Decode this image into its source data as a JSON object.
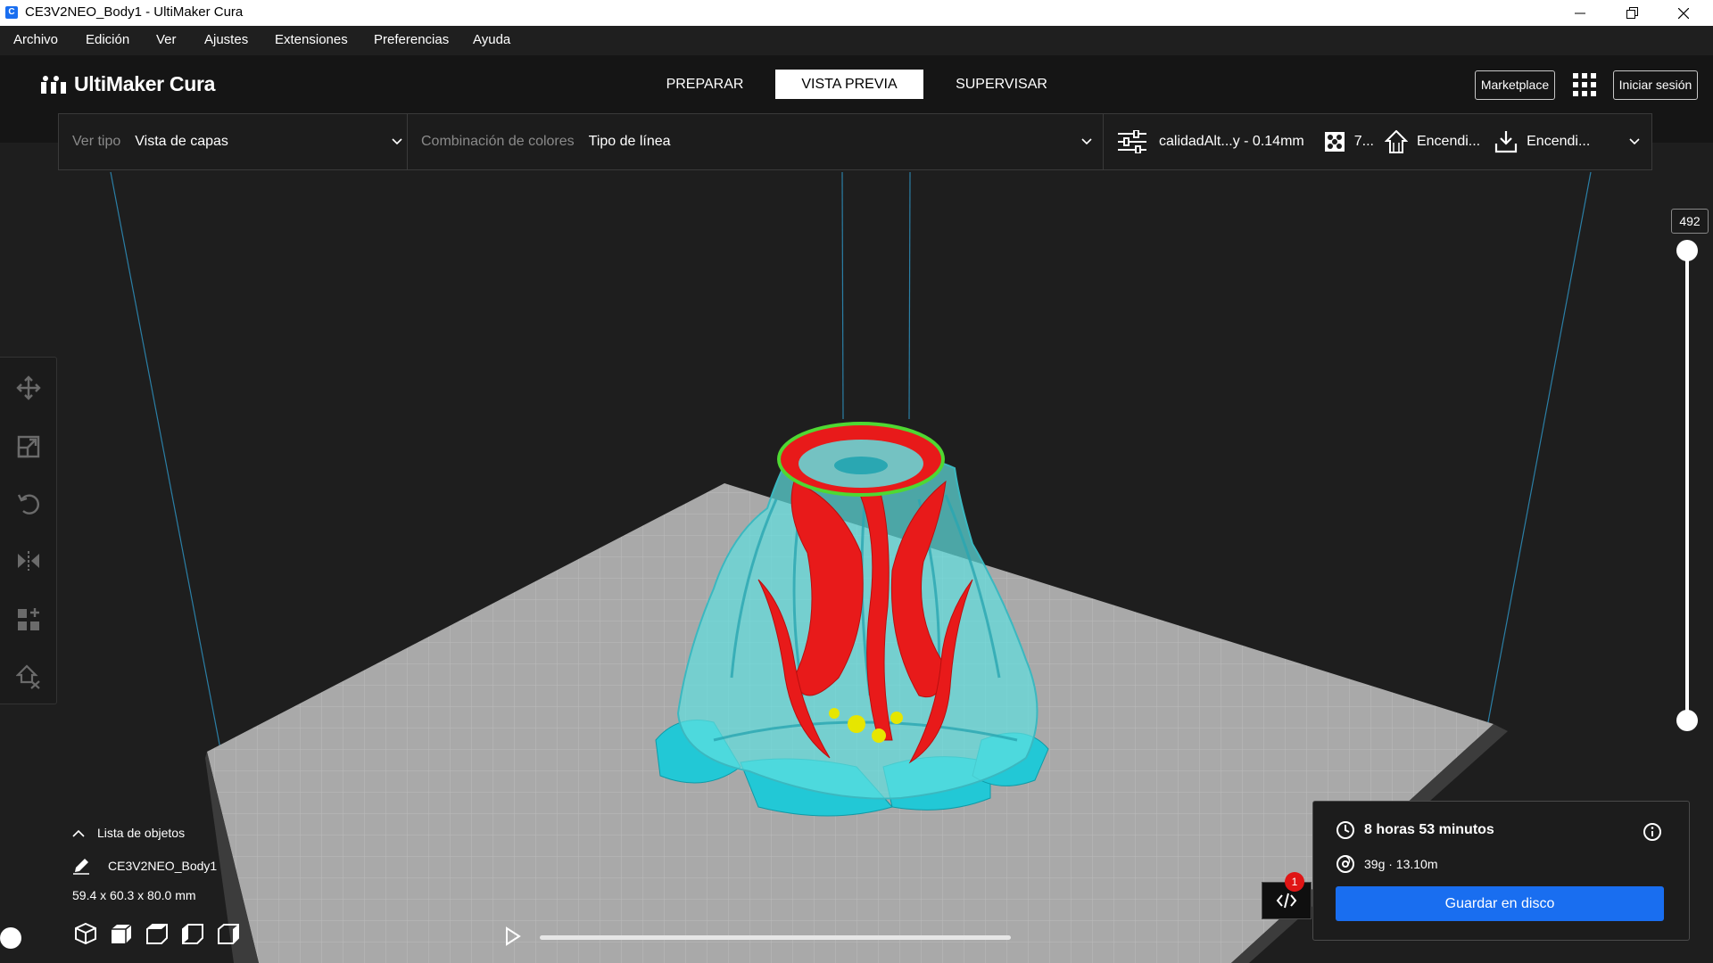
{
  "window": {
    "title": "CE3V2NEO_Body1 - UltiMaker Cura",
    "app_icon": "C",
    "controls": [
      "minimize-icon",
      "restore-icon",
      "close-icon"
    ]
  },
  "menu": [
    "Archivo",
    "Edición",
    "Ver",
    "Ajustes",
    "Extensiones",
    "Preferencias",
    "Ayuda"
  ],
  "header": {
    "logo": "UltiMaker Cura",
    "tabs": [
      {
        "label": "PREPARAR",
        "active": false
      },
      {
        "label": "VISTA PREVIA",
        "active": true
      },
      {
        "label": "SUPERVISAR",
        "active": false
      }
    ],
    "marketplace": "Marketplace",
    "signin": "Iniciar sesión"
  },
  "settings": {
    "view_type_label": "Ver tipo",
    "view_type_value": "Vista de capas",
    "color_scheme_label": "Combinación de colores",
    "color_scheme_value": "Tipo de línea",
    "profile": "calidadAlt...y - 0.14mm",
    "infill": "7...",
    "support": "Encendi...",
    "adhesion": "Encendi..."
  },
  "layer_slider": {
    "top_value": "492"
  },
  "object_list": {
    "header": "Lista de objetos",
    "object_name": "CE3V2NEO_Body1",
    "dimensions": "59.4 x 60.3 x 80.0 mm"
  },
  "playback": {
    "progress": 0.9
  },
  "print_info": {
    "time": "8 horas 53 minutos",
    "material": "39g · 13.10m",
    "save_label": "Guardar en disco"
  },
  "notification": {
    "count": "1"
  },
  "colors": {
    "accent": "#196ef0",
    "shell": "#5fe0e0",
    "wall_outer": "#ff1e1e",
    "infill": "#e6e600",
    "top_skin": "#5fd33a"
  }
}
